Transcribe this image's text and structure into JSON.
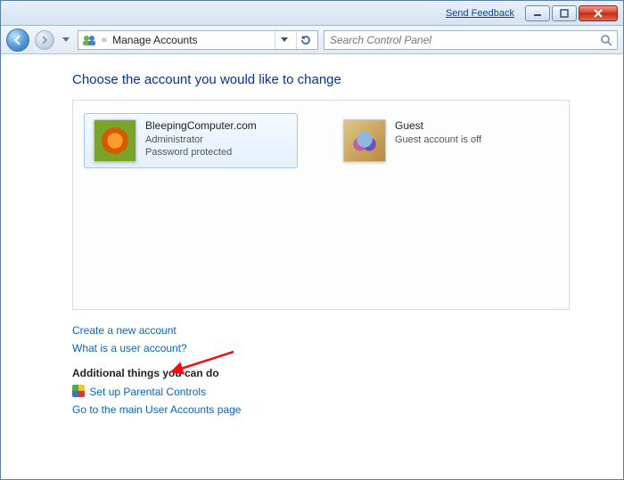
{
  "titlebar": {
    "feedback_label": "Send Feedback"
  },
  "nav": {
    "breadcrumb_prefix": "«",
    "breadcrumb_text": "Manage Accounts"
  },
  "search": {
    "placeholder": "Search Control Panel"
  },
  "heading": "Choose the account you would like to change",
  "accounts": [
    {
      "name": "BleepingComputer.com",
      "line2": "Administrator",
      "line3": "Password protected",
      "selected": true,
      "avatar": "flower"
    },
    {
      "name": "Guest",
      "line2": "Guest account is off",
      "line3": "",
      "selected": false,
      "avatar": "guest"
    }
  ],
  "links": {
    "create_account": "Create a new account",
    "what_is_account": "What is a user account?"
  },
  "additional": {
    "header": "Additional things you can do",
    "parental_controls": "Set up Parental Controls",
    "main_page": "Go to the main User Accounts page"
  }
}
